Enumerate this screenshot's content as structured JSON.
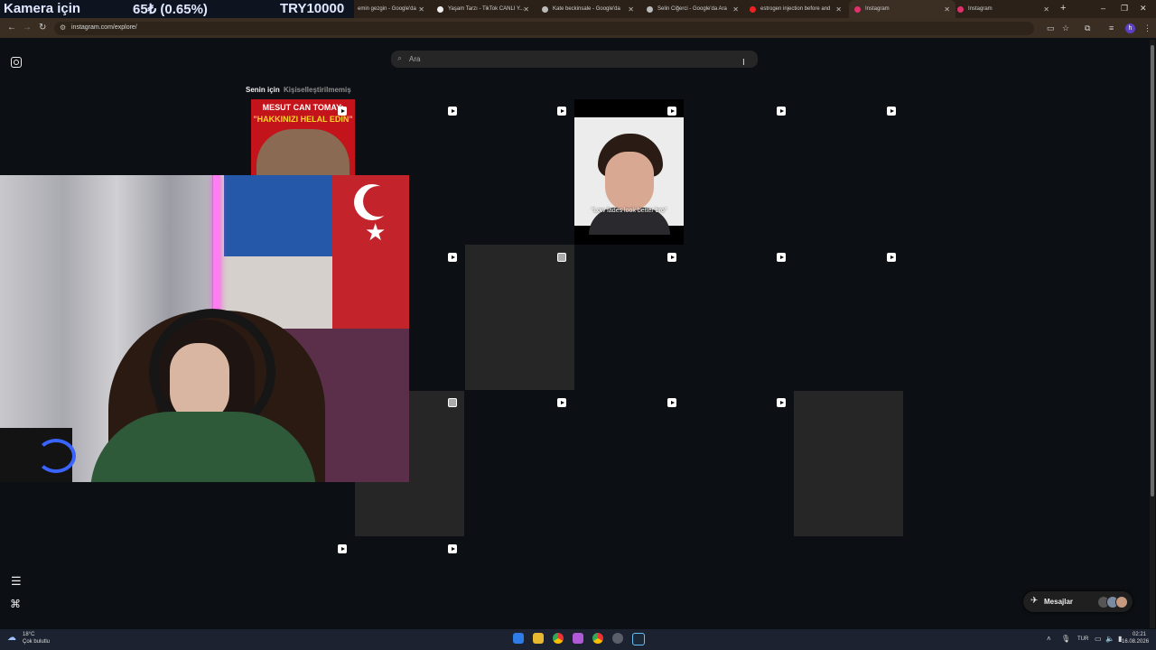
{
  "stream_overlay": {
    "label": "Kamera için",
    "price": "65₺ (0.65%)",
    "goal": "TRY10000"
  },
  "browser": {
    "tabs": [
      {
        "label": "emin gezgin - Google'da"
      },
      {
        "label": "Yaşam Tarzı - TikTok CANLI Y..."
      },
      {
        "label": "Kate beckinsale - Google'da"
      },
      {
        "label": "Selin Ciğerci - Google'da Ara"
      },
      {
        "label": "estrogen injection before and"
      },
      {
        "label": "Instagram"
      },
      {
        "label": "Instagram"
      }
    ],
    "new_tab": "+",
    "url": "instagram.com/explore/",
    "profile_initial": "h"
  },
  "search": {
    "placeholder": "Ara"
  },
  "feed_tabs": {
    "for_you": "Senin için",
    "non_personalized": "Kişiselleştirilmemiş"
  },
  "thumbnails": {
    "post1": {
      "line1": "MESUT CAN TOMAY:",
      "line2": "\"HAKKINIZI HELAL EDİN\""
    },
    "post2": {
      "caption": "\"Low fades look better bro\""
    }
  },
  "messages": {
    "label": "Mesajlar"
  },
  "taskbar": {
    "weather_temp": "18°C",
    "weather_desc": "Çok bulutlu",
    "lang": "TUR",
    "time": "02:21",
    "date": "16.08.2026"
  },
  "colors": {
    "background": "#0c1014",
    "tile_gray": "#262626",
    "banner": "#0e1320"
  }
}
